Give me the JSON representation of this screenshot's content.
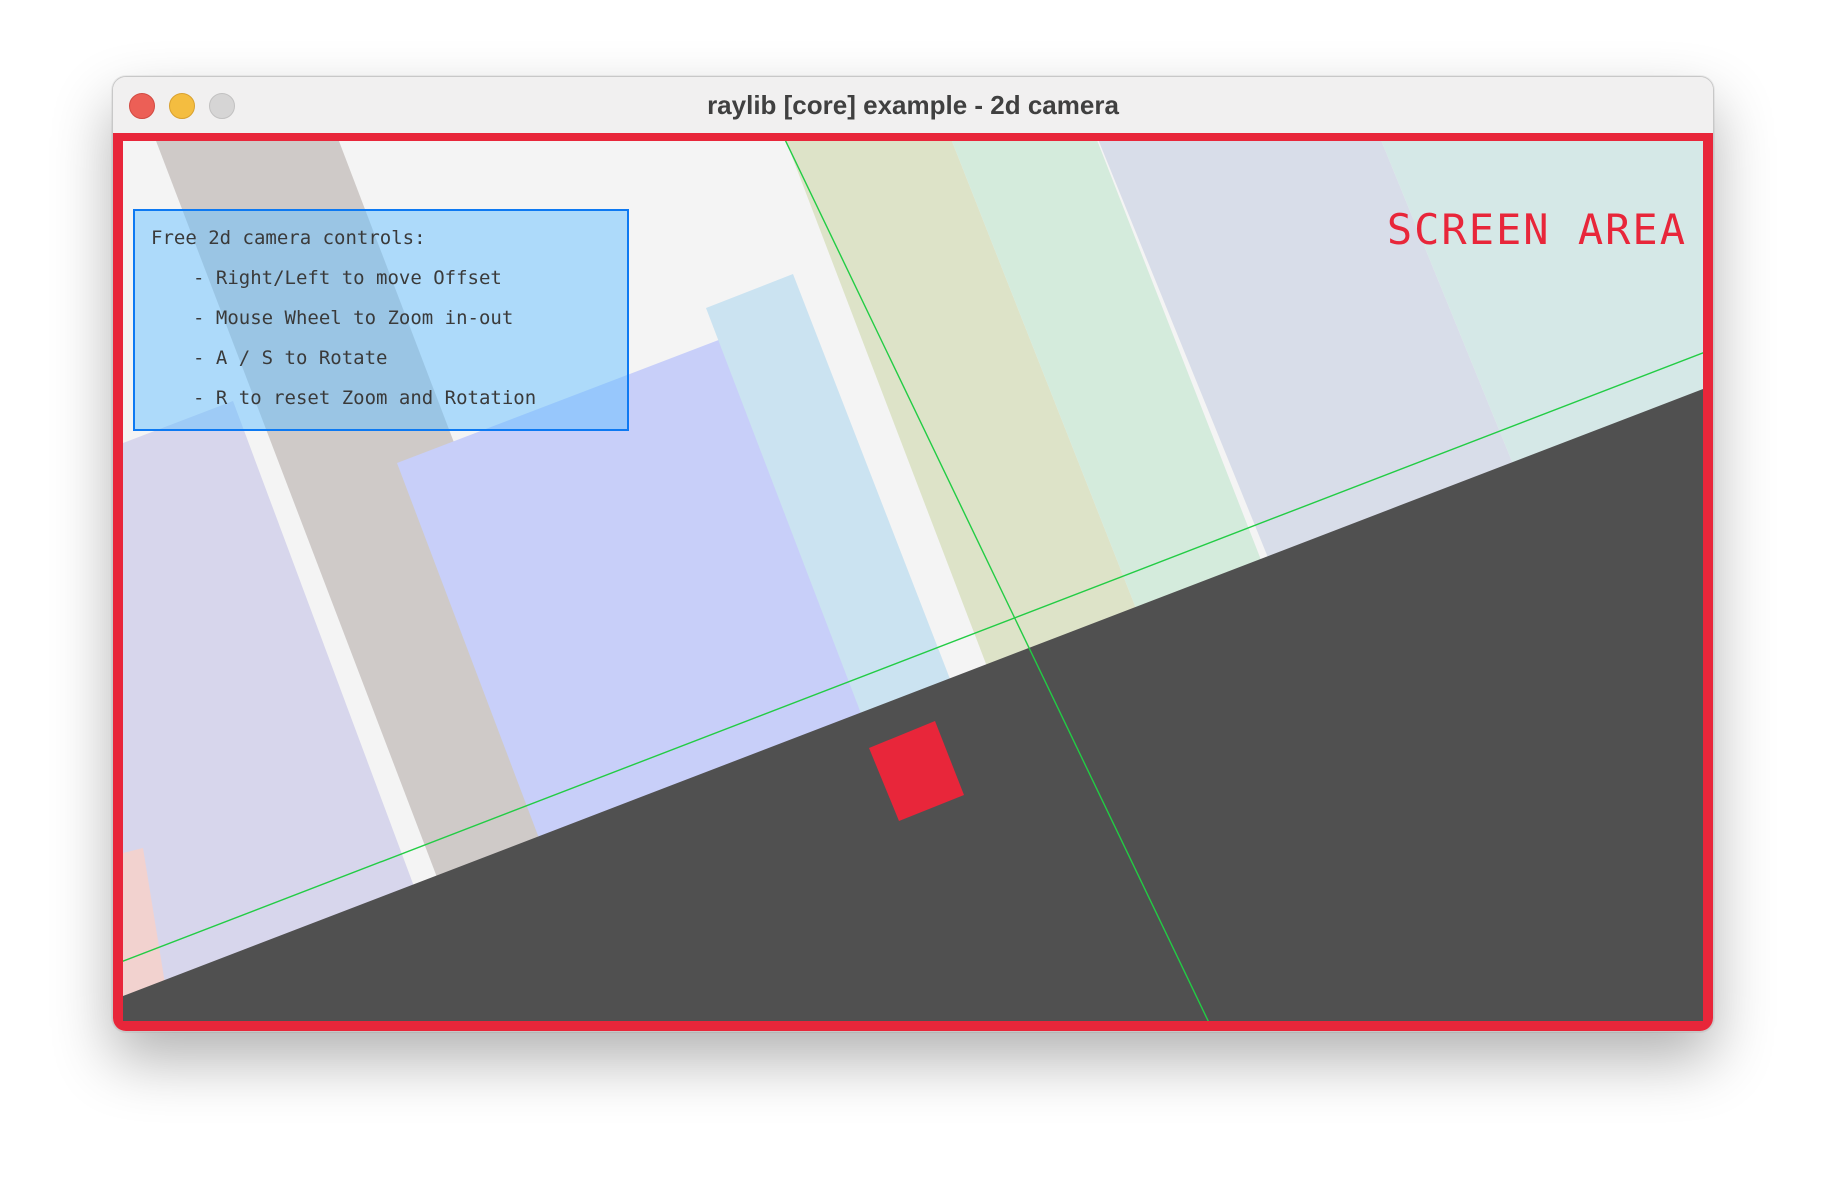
{
  "window": {
    "title": "raylib [core] example - 2d camera",
    "buttons": [
      "close-icon",
      "minimize-icon",
      "zoom-icon"
    ]
  },
  "help_panel": {
    "heading": "Free 2d camera controls:",
    "lines": [
      "- Right/Left to move Offset",
      "- Mouse Wheel to Zoom in-out",
      "- A / S to Rotate",
      "- R to reset Zoom and Rotation"
    ]
  },
  "screen_label": "SCREEN AREA",
  "colors": {
    "frame": "#e8263a",
    "ground": "#505050",
    "player": "#e8263a",
    "guide_lines": "#22cc44",
    "help_fill": "#66bfff",
    "help_border": "#0d79f2"
  }
}
